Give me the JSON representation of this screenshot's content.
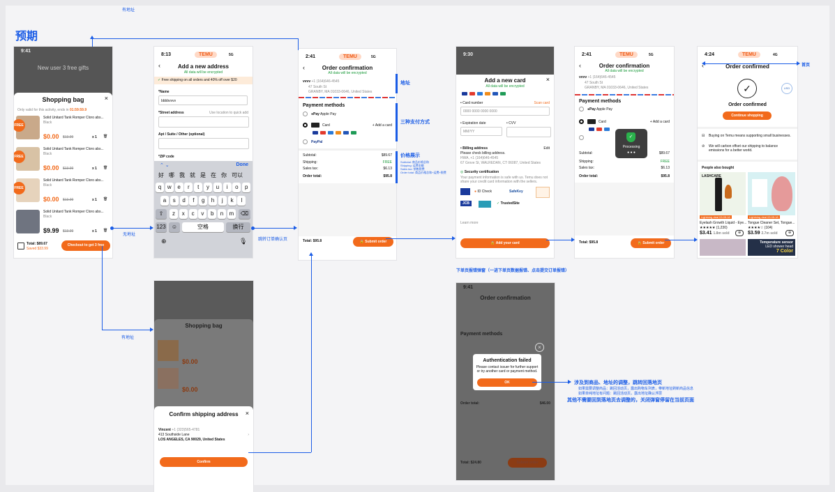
{
  "annotations": {
    "top_note": "有地址",
    "heading": "预期",
    "no_address": "无地址",
    "has_address": "有地址",
    "jump_confirm": "跳转订单确认页",
    "address": "地址",
    "three_pay": "三种支付方式",
    "price_show": "价格展示",
    "price_sub1": "Subtotal: 商品价格总和",
    "price_sub2": "Shipping: 运费金额",
    "price_sub3": "Sales tax: 销售税费",
    "price_sub4": "Order total: 商品价格总和+运费+税费",
    "homepage": "首页",
    "error_popup_title": "下单页报错弹窗（一进下单页数据报错、点击提交订单报错）",
    "rule1": "涉及到商品、地址的调整，跳转回落地页",
    "rule2": "如果需要调整商品：跳回活动页，露出购物车列表，带新地址刷新商品信息",
    "rule3": "如果单纯地址有问题：跳回活动页，露出地址确认浮层",
    "rule4": "其他不需要回到落地页去调整的，关闭弹窗停留在当前页面"
  },
  "bag": {
    "status_time": "9:41",
    "bg_title": "New user 3 free gifts",
    "title": "Shopping bag",
    "notice": "Only valid for this activity, ends in",
    "countdown": "01:59:59.9",
    "items": [
      {
        "name": "Solid Unitard Tank Romper Cloro abs...",
        "variant": "Black",
        "price": "$0.00",
        "old": "$13.99",
        "qty": "x 1"
      },
      {
        "name": "Solid Unitard Tank Romper Cloro abs...",
        "variant": "Black",
        "price": "$0.00",
        "old": "$13.99",
        "qty": "x 1"
      },
      {
        "name": "Solid Unitard Tank Romper Cloro abs...",
        "variant": "Black",
        "price": "$0.00",
        "old": "$13.99",
        "qty": "x 1"
      },
      {
        "name": "Solid Unitard Tank Romper Cloro abs...",
        "variant": "Black",
        "price": "$9.99",
        "old": "$13.99",
        "qty": "x 1"
      }
    ],
    "free_badge": "FREE",
    "total": "Total: $89.67",
    "saved": "Saved $33.99",
    "checkout": "Checkout to get 3 free"
  },
  "address": {
    "time": "8:13",
    "brand": "TEMU",
    "signal": "5G",
    "title": "Add a new address",
    "encrypted": "All data will be encrypted",
    "free_ship": "Free shipping on all orders and 40% off over $20",
    "name_label": "*Name",
    "name_value": "bbbbvvvv",
    "street_label": "*Street address",
    "street_hint": "Use location to quick add",
    "apt_label": "Apt / Suite / Other (optional)",
    "zip_label": "*ZIP code",
    "done": "Done",
    "candidates": [
      "好",
      "哪",
      "我",
      "就",
      "是",
      "在",
      "你",
      "可以"
    ],
    "row1": [
      "q",
      "w",
      "e",
      "r",
      "t",
      "y",
      "u",
      "i",
      "o",
      "p"
    ],
    "row2": [
      "a",
      "s",
      "d",
      "f",
      "g",
      "h",
      "j",
      "k",
      "l"
    ],
    "row3": [
      "z",
      "x",
      "c",
      "v",
      "b",
      "n",
      "m"
    ],
    "k123": "123",
    "space": "空格",
    "enter": "换行"
  },
  "order": {
    "time": "2:41",
    "brand": "TEMU",
    "signal": "5G",
    "title": "Order confirmation",
    "encrypted": "All data will be encrypted",
    "addr_name": "vvvv",
    "addr_phone": "+1 (164)646-4545",
    "addr_line1": "47 South St",
    "addr_line2": "GRANBY, MA 01033-0646, United States",
    "pm_title": "Payment methods",
    "apple_pay": "Apple Pay",
    "card": "Card",
    "add_card": "+ Add a card",
    "paypal": "PayPal",
    "subtotal_l": "Subtotal:",
    "subtotal_v": "$89.67",
    "shipping_l": "Shipping:",
    "shipping_v": "FREE",
    "tax_l": "Sales tax:",
    "tax_v": "$6.13",
    "total_l": "Order total:",
    "total_v": "$95.8",
    "bottom_total": "Total: $95.8",
    "submit": "Submit order"
  },
  "card": {
    "time": "9:30",
    "title": "Add a new card",
    "encrypted": "All data will be encrypted",
    "number_label": "• Card number",
    "scan": "Scan card",
    "number_ph": "0000 0000 0000 0000",
    "exp_label": "• Expiration date",
    "exp_ph": "MM/YY",
    "cvv_label": "• CVV",
    "billing_label": "• Billing address",
    "edit": "Edit",
    "billing_note": "Please check billing address.",
    "billing_name": "HWA, +1 (164)646-4545",
    "billing_addr": "67 Grove St, WALREDAN, CT 06087, United States",
    "security_title": "Security certification",
    "security_text": "Your payment information is safe with us. Temu does not share your credit card information with the sellers.",
    "safekey": "SafeKey",
    "idcheck": "ID Check",
    "jcb": "JCB",
    "trusted": "TrustedSite",
    "learn": "Learn more",
    "add_btn": "Add your card"
  },
  "processing": {
    "time": "2:41",
    "title": "Order confirmation",
    "encrypted": "All data will be encrypted",
    "addr_name": "vvvv",
    "addr_phone": "+1 (164)646-4545",
    "addr_line1": "47 South St",
    "addr_line2": "GRANBY, MA 01033-0646, United States",
    "pm_title": "Payment methods",
    "apple_pay": "Apple Pay",
    "card": "Card",
    "add_card": "+ Add a card",
    "overlay": "Processing",
    "subtotal_l": "Subtotal:",
    "subtotal_v": "$89.67",
    "shipping_l": "Shipping:",
    "shipping_v": "FREE",
    "tax_l": "Sales tax:",
    "tax_v": "$6.13",
    "total_l": "Order total:",
    "total_v": "$95.8",
    "bottom_total": "Total: $95.8",
    "submit": "Submit order"
  },
  "confirmed": {
    "time": "4:24",
    "brand": "TEMU",
    "signal": "4G",
    "title": "Order confirmed",
    "heading": "Order confirmed",
    "continue": "Continue shopping",
    "info1": "Buying on Temu means supporting small businesses.",
    "info2": "We will carbon offset our shipping to balance emissions for a better world.",
    "also": "People also bought",
    "badge1": "Lightning deal",
    "timer1": "03:05:18",
    "p1_name": "Eyelash Growth Liquid - Eye...",
    "p1_rating": "★★★★★ (1,230)",
    "p1_price": "$3.41",
    "p1_sold": "1.8m sold",
    "p2_name": "Tongue Cleaner Set, Tongue...",
    "p2_rating": "★★★★☆ (104)",
    "p2_price": "$3.59",
    "p2_sold": "2.7m sold",
    "ad_text": "Temperature sensor",
    "ad_text2": "LED shower head",
    "ad_color": "7 Color",
    "brand_small": "LASHCARE"
  },
  "ship_confirm": {
    "title": "Confirm shipping address",
    "name": "Vincent",
    "phone": "+1 (323)565-4781",
    "line1": "413 Southside Lane",
    "line2": "LOS ANGELES, CA 90029, United States",
    "confirm": "Confirm",
    "bag_title": "Shopping bag"
  },
  "auth": {
    "time": "9:41",
    "title": "Order confirmation",
    "auth_title": "Authentication failed",
    "auth_text": "Please contact issuer for further support or try another card or payment method.",
    "ok": "OK",
    "pm": "Payment methods",
    "bottom_total": "Total: $24.80",
    "submit": "Submit order",
    "order_total": "Order total:",
    "order_total_v": "$46.00"
  }
}
